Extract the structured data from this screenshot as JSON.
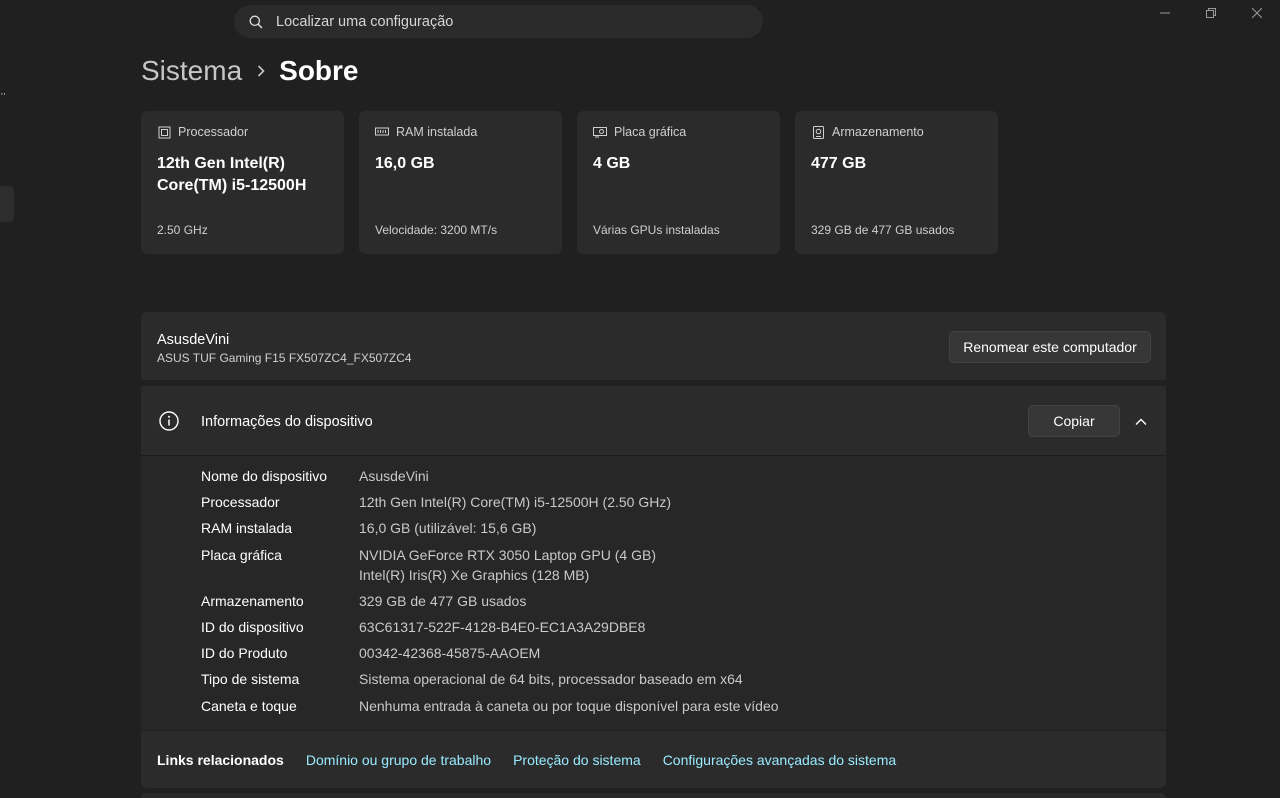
{
  "search": {
    "placeholder": "Localizar uma configuração",
    "icon": "search-icon"
  },
  "window": {
    "controls": [
      "minimize-icon",
      "restore-icon",
      "close-icon"
    ]
  },
  "breadcrumb": {
    "parent": "Sistema",
    "current": "Sobre"
  },
  "cards": [
    {
      "icon": "processor-icon",
      "title": "Processador",
      "value_line1": "12th Gen Intel(R)",
      "value_line2": "Core(TM) i5-12500H",
      "footer": "2.50 GHz"
    },
    {
      "icon": "ram-icon",
      "title": "RAM instalada",
      "value_line1": "16,0 GB",
      "value_line2": "",
      "footer": "Velocidade: 3200 MT/s"
    },
    {
      "icon": "gpu-icon",
      "title": "Placa gráfica",
      "value_line1": "4 GB",
      "value_line2": "",
      "footer": "Várias GPUs instaladas"
    },
    {
      "icon": "storage-icon",
      "title": "Armazenamento",
      "value_line1": "477 GB",
      "value_line2": "",
      "footer": "329 GB de 477 GB usados"
    }
  ],
  "device": {
    "name": "AsusdeVini",
    "model": "ASUS TUF Gaming F15 FX507ZC4_FX507ZC4",
    "rename_label": "Renomear este computador"
  },
  "device_info": {
    "title": "Informações do dispositivo",
    "copy_label": "Copiar",
    "rows": [
      {
        "label": "Nome do dispositivo",
        "value": "AsusdeVini",
        "value2": ""
      },
      {
        "label": "Processador",
        "value": "12th Gen Intel(R) Core(TM) i5-12500H (2.50 GHz)",
        "value2": ""
      },
      {
        "label": "RAM instalada",
        "value": "16,0 GB (utilizável: 15,6 GB)",
        "value2": ""
      },
      {
        "label": "Placa gráfica",
        "value": "NVIDIA GeForce RTX 3050 Laptop GPU (4 GB)",
        "value2": "Intel(R) Iris(R) Xe Graphics (128 MB)"
      },
      {
        "label": "Armazenamento",
        "value": "329 GB de 477 GB usados",
        "value2": ""
      },
      {
        "label": "ID do dispositivo",
        "value": "63C61317-522F-4128-B4E0-EC1A3A29DBE8",
        "value2": ""
      },
      {
        "label": "ID do Produto",
        "value": "00342-42368-45875-AAOEM",
        "value2": ""
      },
      {
        "label": "Tipo de sistema",
        "value": "Sistema operacional de 64 bits, processador baseado em x64",
        "value2": ""
      },
      {
        "label": "Caneta e toque",
        "value": "Nenhuma entrada à caneta ou por toque disponível para este vídeo",
        "value2": ""
      }
    ]
  },
  "related_links": {
    "title": "Links relacionados",
    "links": [
      "Domínio ou grupo de trabalho",
      "Proteção do sistema",
      "Configurações avançadas do sistema"
    ]
  },
  "colors": {
    "background": "#202020",
    "card": "#2b2b2b",
    "link": "#99ebff"
  }
}
